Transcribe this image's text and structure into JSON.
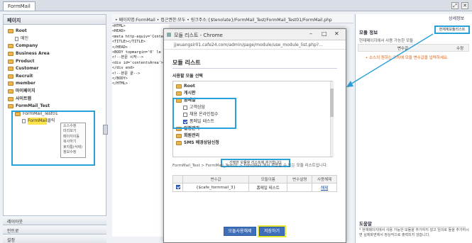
{
  "app": {
    "tab": "FormMail"
  },
  "left": {
    "title": "페이지",
    "tree": [
      {
        "label": "Root",
        "type": "folder",
        "lvl": 0,
        "bold": true
      },
      {
        "label": "메인",
        "type": "page",
        "lvl": 1
      },
      {
        "label": "Company",
        "type": "folder",
        "lvl": 0,
        "bold": true
      },
      {
        "label": "Business Area",
        "type": "folder",
        "lvl": 0,
        "bold": true
      },
      {
        "label": "Product",
        "type": "folder",
        "lvl": 0,
        "bold": true
      },
      {
        "label": "Customer",
        "type": "folder",
        "lvl": 0,
        "bold": true
      },
      {
        "label": "Recruit",
        "type": "folder",
        "lvl": 0,
        "bold": true
      },
      {
        "label": "member",
        "type": "folder",
        "lvl": 0,
        "bold": true
      },
      {
        "label": "마이페이지",
        "type": "folder",
        "lvl": 0,
        "bold": true
      },
      {
        "label": "사이트맵",
        "type": "folder",
        "lvl": 0,
        "bold": true
      },
      {
        "label": "FormMail_Test",
        "type": "folder",
        "lvl": 0,
        "bold": true
      },
      {
        "label": "FormMail_Test01",
        "type": "folder",
        "lvl": 1,
        "bold": false
      },
      {
        "label": "FormMail",
        "type": "page",
        "lvl": 2,
        "bold": false,
        "suffix": "클릭"
      }
    ],
    "context_menu": [
      "소스수정",
      "미리보기",
      "페이지이동",
      "복사하기",
      "휴지통(삭제)",
      "정보수정"
    ],
    "footer": [
      "레이아웃",
      "인트로",
      "설정"
    ]
  },
  "mid": {
    "header": "• 페이지명:FormMail   • 접근권한:모두   • 링크주소:{$tenolate}/FormMail_Test/FormMail_Test01/FormMail.php",
    "code": [
      "<HTML>",
      "<HEAD>",
      "<meta http-equiv='Content",
      "<TITLE></TITLE>",
      "</HEAD>",
      "<BODY topmargin='0' le",
      "<!--본문 시작-->",
      "<div id='contentsArea'>",
      "</div end>",
      "<!--본문 끝-->",
      "</BODY>",
      "</HTML>"
    ]
  },
  "dialog": {
    "title": "모듈 리스트 - Chrome",
    "url": "jjwuangsir01.cafe24.com/admin/page/module/use_module_list.php?...",
    "heading": "모듈 리스트",
    "section": "사용할 모듈 선택",
    "tree": [
      {
        "label": "Root",
        "lvl": 0,
        "type": "folder"
      },
      {
        "label": "게시판",
        "lvl": 0,
        "type": "folder"
      },
      {
        "label": "폼메일",
        "lvl": 0,
        "type": "folder"
      },
      {
        "label": "고객상담",
        "lvl": 1,
        "type": "check",
        "checked": false
      },
      {
        "label": "채용 온라인접수",
        "lvl": 1,
        "type": "check",
        "checked": false
      },
      {
        "label": "폼메일 테스트",
        "lvl": 1,
        "type": "check",
        "checked": true
      },
      {
        "label": "일정관리",
        "lvl": 0,
        "type": "folder"
      },
      {
        "label": "회원관리",
        "lvl": 0,
        "type": "folder"
      },
      {
        "label": "SMS 배경상담신청",
        "lvl": 0,
        "type": "folder"
      }
    ],
    "add_button": "선택한 모듈을 리스트에 추가합니다",
    "path_note": "FormMail_Test > FormMail_Test01 > FormMail 에서 사용할 수 있는 모듈 리스트입니다.",
    "table": {
      "headers": [
        "",
        "변수값",
        "모듈이름",
        "변수설명",
        "사용해제"
      ],
      "rows": [
        {
          "var": "{$cafe_formmail_3}",
          "name": "폼메일 테스트",
          "desc": "",
          "action": "해제"
        }
      ]
    },
    "btn_release": "모듈사용해제",
    "btn_save": "저장하기"
  },
  "right": {
    "title": "모듈 정보",
    "detail_btn": "상세정보",
    "list_btn": "현재계모듈리스트",
    "desc": "현재페이지에서 사용 가능한 모듈",
    "col1": "변수값",
    "col2": "수정",
    "note": "• 소스의 원하는 위치에 모듈 변수값을 입력하세요.",
    "help_title": "도움말",
    "help_text": "* 현재페이지에서 사용 가능한 모듈을 추가하지 않고 임의로 들을 추가하시면 실제화면에서 정상작으로 출력되지 않습니다."
  }
}
